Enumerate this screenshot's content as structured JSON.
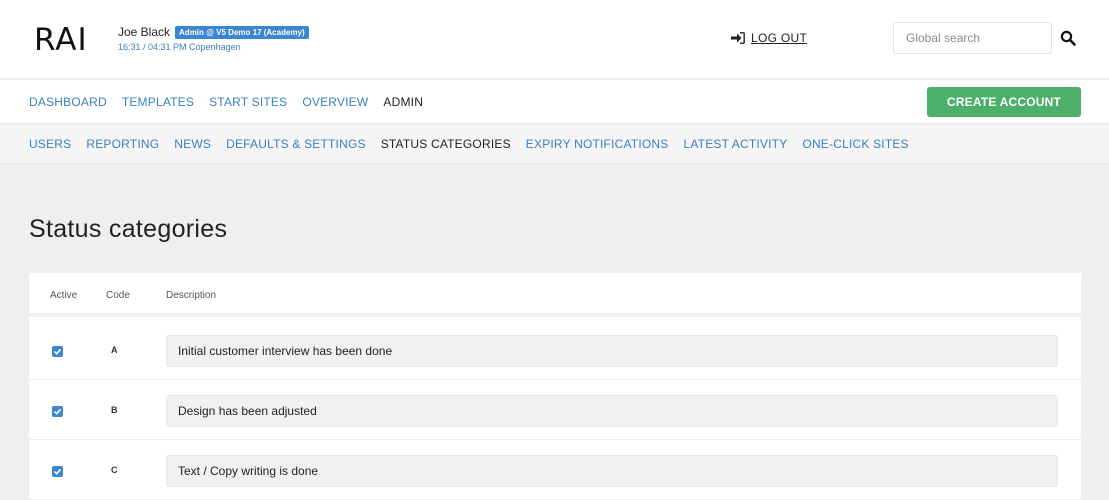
{
  "header": {
    "logo": "RAI",
    "user_name": "Joe Black",
    "account_badge": "Admin @ V5 Demo 17 (Academy)",
    "time": "16:31 / 04:31 PM Copenhagen",
    "logout_label": "LOG OUT",
    "search_placeholder": "Global search"
  },
  "main_nav": {
    "items": [
      {
        "label": "DASHBOARD"
      },
      {
        "label": "TEMPLATES"
      },
      {
        "label": "START SITES"
      },
      {
        "label": "OVERVIEW"
      },
      {
        "label": "ADMIN",
        "active": true
      }
    ],
    "create_account": "CREATE ACCOUNT"
  },
  "sub_nav": {
    "items": [
      {
        "label": "USERS"
      },
      {
        "label": "REPORTING"
      },
      {
        "label": "NEWS"
      },
      {
        "label": "DEFAULTS & SETTINGS"
      },
      {
        "label": "STATUS CATEGORIES",
        "active": true
      },
      {
        "label": "EXPIRY NOTIFICATIONS"
      },
      {
        "label": "LATEST ACTIVITY"
      },
      {
        "label": "ONE-CLICK SITES"
      }
    ]
  },
  "page": {
    "title": "Status categories"
  },
  "table": {
    "headers": {
      "active": "Active",
      "code": "Code",
      "description": "Description"
    },
    "rows": [
      {
        "active": true,
        "code": "A",
        "description": "Initial customer interview has been done"
      },
      {
        "active": true,
        "code": "B",
        "description": "Design has been adjusted"
      },
      {
        "active": true,
        "code": "C",
        "description": "Text / Copy writing is done"
      }
    ]
  },
  "colors": {
    "accent_blue": "#3a87cf",
    "link_blue": "#3a7fc1",
    "create_green": "#4caf6a"
  }
}
